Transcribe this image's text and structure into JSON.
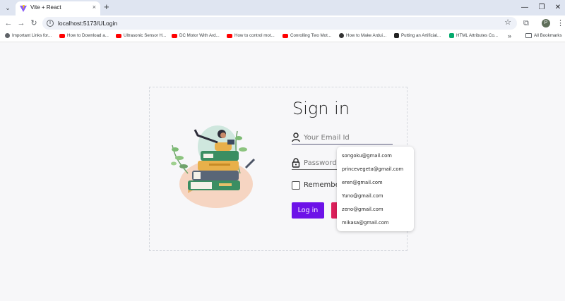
{
  "browser": {
    "tab": {
      "title": "Vite + React",
      "close_glyph": "×"
    },
    "tab_list_glyph": "⌄",
    "new_tab_glyph": "+",
    "window_controls": {
      "minimize": "—",
      "restore": "❐",
      "close": "✕"
    },
    "nav": {
      "back": "←",
      "forward": "→",
      "reload": "↻"
    },
    "address": {
      "url": "localhost:5173/ULogin",
      "info_glyph": "i",
      "star_glyph": "☆"
    },
    "extensions_glyph": "⧉",
    "profile_initial": "P",
    "menu_glyph": "⋮",
    "bookmarks": [
      {
        "label": "Important Links for...",
        "icon": "globe-icon",
        "color": "#5f6368"
      },
      {
        "label": "How to Download a...",
        "icon": "youtube-icon",
        "color": "#ff0000"
      },
      {
        "label": "Ultrasonic Sensor H...",
        "icon": "youtube-icon",
        "color": "#ff0000"
      },
      {
        "label": "DC Motor With Ard...",
        "icon": "youtube-icon",
        "color": "#ff0000"
      },
      {
        "label": "How to control mot...",
        "icon": "youtube-icon",
        "color": "#ff0000"
      },
      {
        "label": "Conrolling Two Mot...",
        "icon": "youtube-icon",
        "color": "#ff0000"
      },
      {
        "label": "How to Make Ardui...",
        "icon": "instructables-icon",
        "color": "#333333"
      },
      {
        "label": "Putting an Artificial...",
        "icon": "bookmark-site-icon",
        "color": "#222222"
      },
      {
        "label": "HTML Attributes Co...",
        "icon": "w3-icon",
        "color": "#04aa6d"
      }
    ],
    "bookmarks_more": "»",
    "all_bookmarks": "All Bookmarks"
  },
  "login": {
    "title": "Sign in",
    "email_placeholder": "Your Email Id",
    "password_placeholder": "Password",
    "remember_label": "Remember",
    "login_button": "Log in",
    "autocomplete_options": [
      "songoku@gmail.com",
      "princevegeta@gmail.com",
      "eren@gmail.com",
      "Yuno@gmail.com",
      "zeno@gmail.com",
      "mikasa@gmail.com"
    ]
  },
  "colors": {
    "login_button": "#6d12e8",
    "secondary_button": "#dc1f5a",
    "page_background": "#f7f7f9"
  }
}
